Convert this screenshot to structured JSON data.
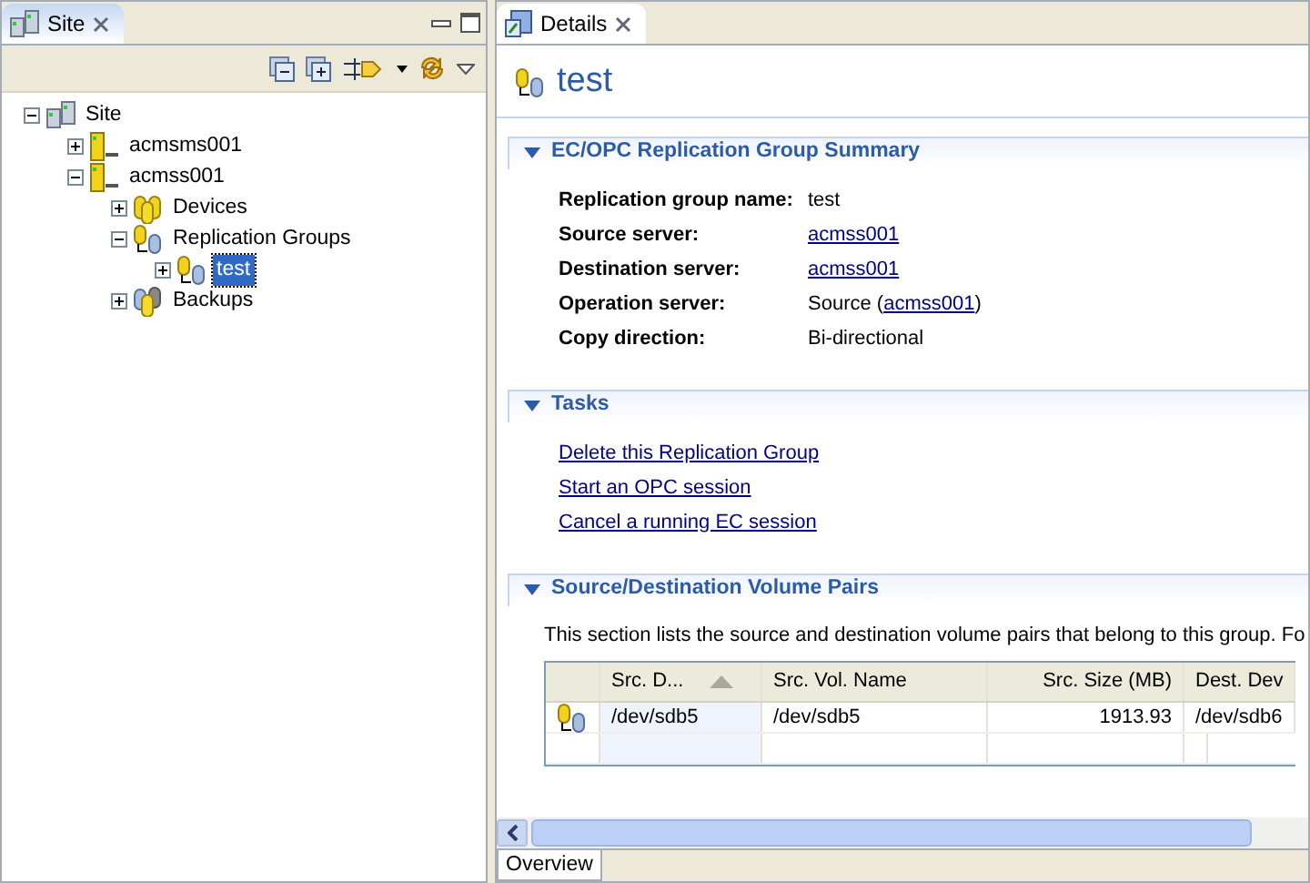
{
  "site_view": {
    "tab": {
      "label": "Site",
      "selected": true
    },
    "tree": [
      {
        "label": "Site",
        "kind": "site",
        "expanded": true,
        "selected": false,
        "children": [
          {
            "label": "acmsms001",
            "kind": "server",
            "expanded": false,
            "selected": false
          },
          {
            "label": "acmss001",
            "kind": "server",
            "expanded": true,
            "selected": false,
            "children": [
              {
                "label": "Devices",
                "kind": "devices",
                "expanded": false,
                "selected": false
              },
              {
                "label": "Replication Groups",
                "kind": "group",
                "expanded": true,
                "selected": false,
                "children": [
                  {
                    "label": "test",
                    "kind": "group",
                    "expanded": false,
                    "selected": true
                  }
                ]
              },
              {
                "label": "Backups",
                "kind": "backups",
                "expanded": false,
                "selected": false
              }
            ]
          }
        ]
      }
    ]
  },
  "details_view": {
    "tab": {
      "label": "Details",
      "selected": true
    },
    "title": "test",
    "summary": {
      "heading": "EC/OPC Replication Group Summary",
      "expanded": true,
      "fields": [
        {
          "label": "Replication group name:",
          "parts": [
            {
              "text": "test",
              "link": false
            }
          ]
        },
        {
          "label": "Source server:",
          "parts": [
            {
              "text": "acmss001",
              "link": true
            }
          ]
        },
        {
          "label": "Destination server:",
          "parts": [
            {
              "text": "acmss001",
              "link": true
            }
          ]
        },
        {
          "label": "Operation server:",
          "parts": [
            {
              "text": "Source (",
              "link": false
            },
            {
              "text": "acmss001",
              "link": true
            },
            {
              "text": ")",
              "link": false
            }
          ]
        },
        {
          "label": "Copy direction:",
          "parts": [
            {
              "text": "Bi-directional",
              "link": false
            }
          ]
        }
      ]
    },
    "tasks": {
      "heading": "Tasks",
      "expanded": true,
      "links": [
        "Delete this Replication Group",
        "Start an OPC session",
        "Cancel a running EC session"
      ]
    },
    "pairs": {
      "heading": "Source/Destination Volume Pairs",
      "expanded": true,
      "description": "This section lists the source and destination volume pairs that belong to this group. Fo",
      "columns": [
        {
          "label": "Src. D...",
          "sorted": true,
          "kind": "text"
        },
        {
          "label": "Src. Vol. Name",
          "sorted": false,
          "kind": "text"
        },
        {
          "label": "Src. Size (MB)",
          "sorted": false,
          "kind": "number"
        },
        {
          "label": "Dest. Dev",
          "sorted": false,
          "kind": "text"
        }
      ],
      "rows": [
        {
          "cells": [
            "/dev/sdb5",
            "/dev/sdb5",
            "1913.93",
            "/dev/sdb6"
          ]
        }
      ]
    },
    "bottom_tabs": [
      {
        "label": "Overview",
        "selected": true
      }
    ]
  }
}
